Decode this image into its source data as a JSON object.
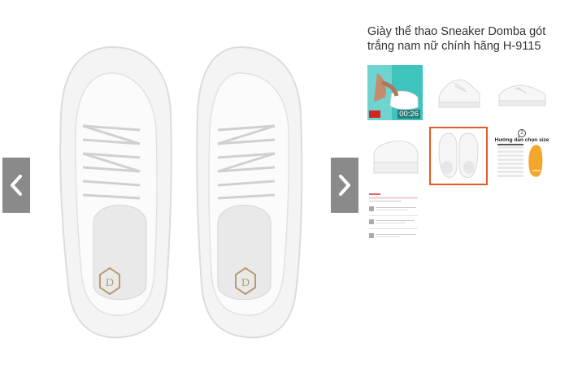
{
  "product": {
    "title": "Giày thể thao Sneaker Domba gót trắng nam nữ chính hãng H-9115"
  },
  "gallery": {
    "video_duration": "00:26",
    "size_guide_number": "2",
    "size_guide_title": "Hướng dẫn chọn size",
    "selected_index": 4
  },
  "colors": {
    "selected_border": "#e55a2b",
    "nav_button": "#8a8a8a"
  }
}
